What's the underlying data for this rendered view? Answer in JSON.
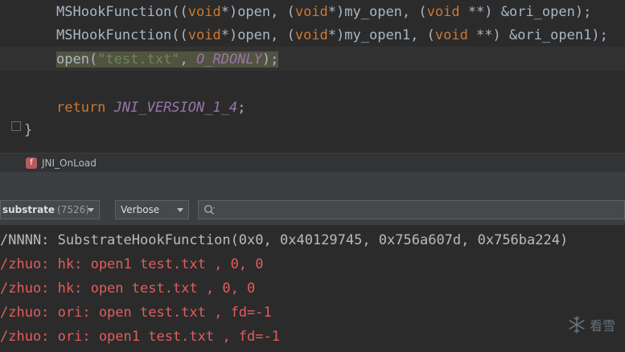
{
  "editor": {
    "lines": [
      {
        "parts": [
          {
            "t": "MSHookFunction((",
            "c": "plain"
          },
          {
            "t": "void",
            "c": "kw"
          },
          {
            "t": "*)open, (",
            "c": "plain"
          },
          {
            "t": "void",
            "c": "kw"
          },
          {
            "t": "*)my_open, (",
            "c": "plain"
          },
          {
            "t": "void",
            "c": "kw"
          },
          {
            "t": " **) &ori_open);",
            "c": "plain"
          }
        ]
      },
      {
        "parts": [
          {
            "t": "MSHookFunction((",
            "c": "plain"
          },
          {
            "t": "void",
            "c": "kw"
          },
          {
            "t": "*)open, (",
            "c": "plain"
          },
          {
            "t": "void",
            "c": "kw"
          },
          {
            "t": "*)my_open1, (",
            "c": "plain"
          },
          {
            "t": "void",
            "c": "kw"
          },
          {
            "t": " **) &ori_open1);",
            "c": "plain"
          }
        ]
      },
      {
        "parts": [
          {
            "t": "open(",
            "c": "plain"
          },
          {
            "t": "\"test.txt\"",
            "c": "str"
          },
          {
            "t": ", ",
            "c": "plain"
          },
          {
            "t": "O_RDONLY",
            "c": "const"
          },
          {
            "t": ");",
            "c": "plain"
          }
        ]
      },
      {
        "parts": []
      },
      {
        "parts": [
          {
            "t": "return ",
            "c": "kw"
          },
          {
            "t": "JNI_VERSION_1_4",
            "c": "const"
          },
          {
            "t": ";",
            "c": "plain"
          }
        ]
      }
    ],
    "closing_brace": "}"
  },
  "breadcrumb": {
    "badge": "f",
    "label": "JNI_OnLoad"
  },
  "logcat": {
    "process_name": "substrate",
    "process_pid": "(7526)",
    "log_level": "Verbose",
    "search_value": "",
    "lines": [
      {
        "text": "/NNNN: SubstrateHookFunction(0x0, 0x40129745, 0x756a607d, 0x756ba224)",
        "level": "info"
      },
      {
        "text": "/zhuo: hk: open1 test.txt , 0, 0",
        "level": "err"
      },
      {
        "text": "/zhuo: hk: open test.txt , 0, 0",
        "level": "err"
      },
      {
        "text": "/zhuo: ori: open test.txt , fd=-1",
        "level": "err"
      },
      {
        "text": "/zhuo: ori: open1 test.txt , fd=-1",
        "level": "err"
      }
    ]
  },
  "watermark": {
    "text": "看雪",
    "icon": "snowflake-icon"
  },
  "colors": {
    "keyword": "#cc7832",
    "string": "#6a8759",
    "constant": "#9876aa",
    "error_log": "#e55b5b",
    "info_log": "#bbbbbb"
  }
}
